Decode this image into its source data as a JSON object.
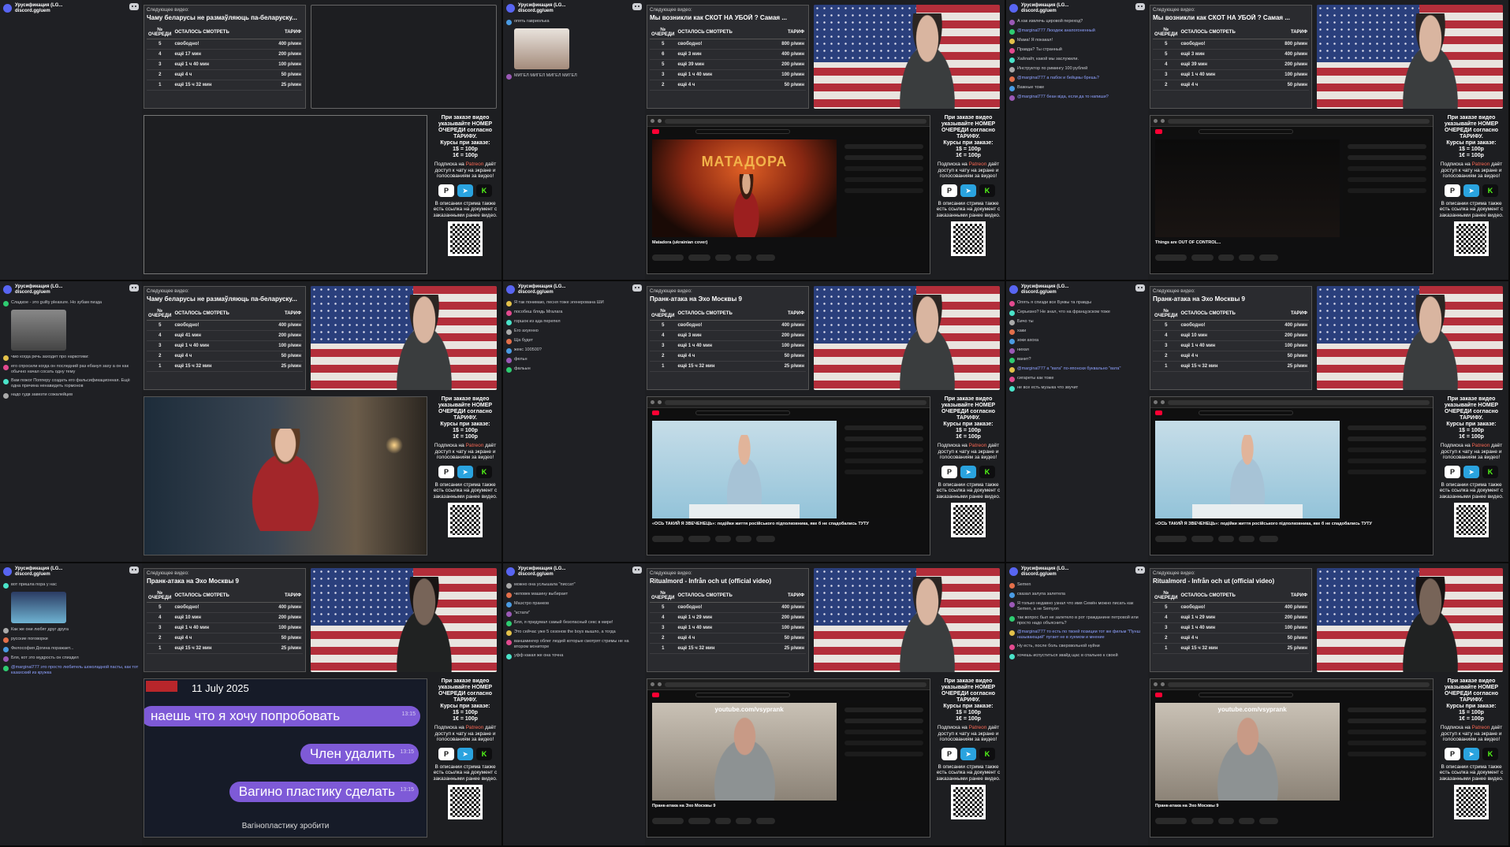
{
  "common": {
    "server_name": "Урусификация (LG...",
    "server_invite": "discord.gg/uem",
    "next_label": "Следующее видео:",
    "queue_header": [
      "№ ОЧЕРЕДИ",
      "ОСТАЛОСЬ СМОТРЕТЬ",
      "ТАРИФ"
    ],
    "side_text": "При заказе видео указывайте НОМЕР ОЧЕРЕДИ согласно ТАРИФУ.",
    "rates_title": "Курсы при заказе:",
    "rate_usd": "1$ = 100р",
    "rate_eur": "1€ = 100р",
    "sub_line1": "Подписка на",
    "sub_patreon": "Patreon",
    "sub_line2": "даёт доступ к чату на экране и голосованиям за видео!",
    "doc_text": "В описании стрима также есть ссылка на документ с заказанными ранее видео.",
    "colors": {
      "free": "#29d444",
      "patreon": "#f96854",
      "discord": "#5865f2",
      "telegram": "#2aa3df",
      "kick": "#53fc18"
    }
  },
  "tiles": [
    {
      "title": "Чаму беларусы не размаўляюць па-беларуску...",
      "rows": [
        [
          "5",
          "свободно!",
          "400 р/мин"
        ],
        [
          "4",
          "ещё 17 мин",
          "200 р/мин"
        ],
        [
          "3",
          "ещё 1 ч 40 мин",
          "100 р/мин"
        ],
        [
          "2",
          "ещё 4 ч",
          "50 р/мин"
        ],
        [
          "1",
          "ещё 15 ч 32 мин",
          "25 р/мин"
        ]
      ],
      "caption": "",
      "chat": []
    },
    {
      "title": "Мы возникли как СКОТ НА УБОЙ ? Самая ...",
      "rows": [
        [
          "5",
          "свободно!",
          "800 р/мин"
        ],
        [
          "6",
          "ещё 3 мин",
          "400 р/мин"
        ],
        [
          "5",
          "ещё 39 мин",
          "200 р/мин"
        ],
        [
          "3",
          "ещё 1 ч 40 мин",
          "100 р/мин"
        ],
        [
          "2",
          "ещё 4 ч",
          "50 р/мин"
        ]
      ],
      "caption": "Matadora (ukrainian cover)",
      "poster_title": "МАТАДОРА",
      "chat": [
        "опять гавриолька",
        "МИГЕЛ МИГЕЛ МИГЕЛ МИГЕЛ"
      ]
    },
    {
      "title": "Мы возникли как СКОТ НА УБОЙ ? Самая ...",
      "rows": [
        [
          "5",
          "свободно!",
          "800 р/мин"
        ],
        [
          "5",
          "ещё 3 мин",
          "400 р/мин"
        ],
        [
          "4",
          "ещё 39 мин",
          "200 р/мин"
        ],
        [
          "3",
          "ещё 1 ч 40 мин",
          "100 р/мин"
        ],
        [
          "2",
          "ещё 4 ч",
          "50 р/мин"
        ]
      ],
      "caption": "Things are OUT OF CONTROL...",
      "chat": [
        "А как извлечь цировой переход?",
        "@marginal777 Люодеж анапогоненный",
        "Мама! Я покакал!",
        "Правда? Ты странный",
        "Хайлайт, какой мы заслужили.",
        "Инструктор по римингу 100 рублей",
        "@marginal777 а пабок и бейцмы брешь?",
        "Важные тоже",
        "@marginal777 бeaн вiда, если да то напиши?"
      ]
    },
    {
      "title": "Чаму беларусы не размаўляюць па-беларуску...",
      "rows": [
        [
          "5",
          "свободно!",
          "400 р/мин"
        ],
        [
          "4",
          "ещё 41 мин",
          "200 р/мин"
        ],
        [
          "3",
          "ещё 1 ч 40 мин",
          "100 р/мин"
        ],
        [
          "2",
          "ещё 4 ч",
          "50 р/мин"
        ],
        [
          "1",
          "ещё 15 ч 32 мин",
          "25 р/мин"
        ]
      ],
      "caption": "",
      "chat": [
        "Сладкое - это guilty pleasure. Но зубам пизда",
        "чмо когда речь заходит про наркотики:",
        "его спросили когда он последний раз ебанул заху а он как обычно начал сосать одну тему",
        "Вам пожог Попперу создать его фальсификационная. Ещё одна причина ненавидеть гормонов",
        "надо гудв завезти сожалейцев"
      ]
    },
    {
      "title": "Пранк-атака на Эхо Москвы 9",
      "rows": [
        [
          "5",
          "свободно!",
          "400 р/мин"
        ],
        [
          "4",
          "ещё 3 мин",
          "200 р/мин"
        ],
        [
          "3",
          "ещё 1 ч 40 мин",
          "100 р/мин"
        ],
        [
          "2",
          "ещё 4 ч",
          "50 р/мин"
        ],
        [
          "1",
          "ещё 15 ч 32 мин",
          "25 р/мин"
        ]
      ],
      "caption": "«ОСЬ ТАКИЙ Я ЗВЕЧЕНЕЦЬ»: подійки життя російського підполковника, яке б не спадобались ТУТУ",
      "chat": [
        "Я так понимаю, песня тоже эгенерована ШИ",
        "пособеш блядь Мгалага",
        "горшок из ада перепел",
        "Его ахуенно",
        "Ща будет",
        "жекс 100500?",
        "фельн",
        "фальын"
      ]
    },
    {
      "title": "Пранк-атака на Эхо Москвы 9",
      "rows": [
        [
          "5",
          "свободно!",
          "400 р/мин"
        ],
        [
          "4",
          "ещё 10 мин",
          "200 р/мин"
        ],
        [
          "3",
          "ещё 1 ч 40 мин",
          "100 р/мин"
        ],
        [
          "2",
          "ещё 4 ч",
          "50 р/мин"
        ],
        [
          "1",
          "ещё 15 ч 32 мин",
          "25 р/мин"
        ]
      ],
      "caption": "«ОСЬ ТАКИЙ Я ЗВЕЧЕНЕЦЬ»: подійки життя російського підполковника, яке б не спадобались ТУТУ",
      "chat": [
        "Опять я спизди все Буквы та правды",
        "Серьезно? Не знал, что на французском тоже",
        "Бичо ты",
        "хаки",
        "зоки ахоха",
        "нихая",
        "ванит?",
        "@marginal777 а \"вата\" по-японски буквально \"вата\"",
        "сигареты как тоже",
        "не все есть музыка что звучит"
      ]
    },
    {
      "title": "Пранк-атака на Эхо Москвы 9",
      "rows": [
        [
          "5",
          "свободно!",
          "400 р/мин"
        ],
        [
          "4",
          "ещё 10 мин",
          "200 р/мин"
        ],
        [
          "3",
          "ещё 1 ч 40 мин",
          "100 р/мин"
        ],
        [
          "2",
          "ещё 4 ч",
          "50 р/мин"
        ],
        [
          "1",
          "ещё 15 ч 32 мин",
          "25 р/мин"
        ]
      ],
      "caption": "",
      "date": "11 July 2025",
      "bubbles": [
        [
          "наешь что я хочу попробовать",
          "13:15"
        ],
        [
          "Член удалить",
          "13:15"
        ],
        [
          "Вагино пластику сделать",
          "13:15"
        ]
      ],
      "bubble_sub": "Вагінопластику зробити",
      "chat": [
        "вот пришла пора у нас",
        "Как же они любят друг друга",
        "русские поговорки",
        "Философия Догина поражает...",
        "Бля, кот это мудрость он спиздил",
        "@marginal777 это просто любитель шоколадной пасты, как тот казахский из кружка"
      ]
    },
    {
      "title": "Ritualmord - Infrån och ut (official video)",
      "rows": [
        [
          "5",
          "свободно!",
          "400 р/мин"
        ],
        [
          "4",
          "ещё 1 ч 29 мин",
          "200 р/мин"
        ],
        [
          "3",
          "ещё 1 ч 40 мин",
          "100 р/мин"
        ],
        [
          "2",
          "ещё 4 ч",
          "50 р/мин"
        ],
        [
          "1",
          "ещё 15 ч 32 мин",
          "25 р/мин"
        ]
      ],
      "caption": "Пранк-атака на Эхо Москвы 9",
      "video_url": "youtube.com/vsyprank",
      "chat": [
        "можно она услышала \"писсат\"",
        "человек машину выбирает",
        "Маэстро пранков",
        "\"кстати\"",
        "Бля, я придумал самый безопасный секс в мире!",
        "Это сейчас уже 5 сезонов the boys вышло, а тогда",
        "ваншмингер облег людей которые смотрят стримы не на втором мониторе",
        "уфф какая же она точна"
      ]
    },
    {
      "title": "Ritualmord - Infrån och ut (official video)",
      "rows": [
        [
          "5",
          "свободно!",
          "400 р/мин"
        ],
        [
          "4",
          "ещё 1 ч 29 мин",
          "200 р/мин"
        ],
        [
          "3",
          "ещё 1 ч 40 мин",
          "100 р/мин"
        ],
        [
          "2",
          "ещё 4 ч",
          "50 р/мин"
        ],
        [
          "1",
          "ещё 15 ч 32 мин",
          "25 р/мин"
        ]
      ],
      "caption": "Пранк-атака на Эхо Москвы 9",
      "video_url": "youtube.com/vsyprank",
      "chat": [
        "Semen",
        "сказал залупа залетела",
        "Я только недавно узнал что имя Семён можно писать как Semen, а не Semyon",
        "так вопрос был не залетело в рот гражданине петровой или просто надо объяснить?",
        "@marginal777 то есть по твоей позиции тот же фильм \"Пунш называющий\" пугает не в хуемом и мнение",
        "Ну есть, после боль сверхвольной нуйни",
        "хочешь испуститься звайд щас в спальню к своей"
      ]
    }
  ]
}
